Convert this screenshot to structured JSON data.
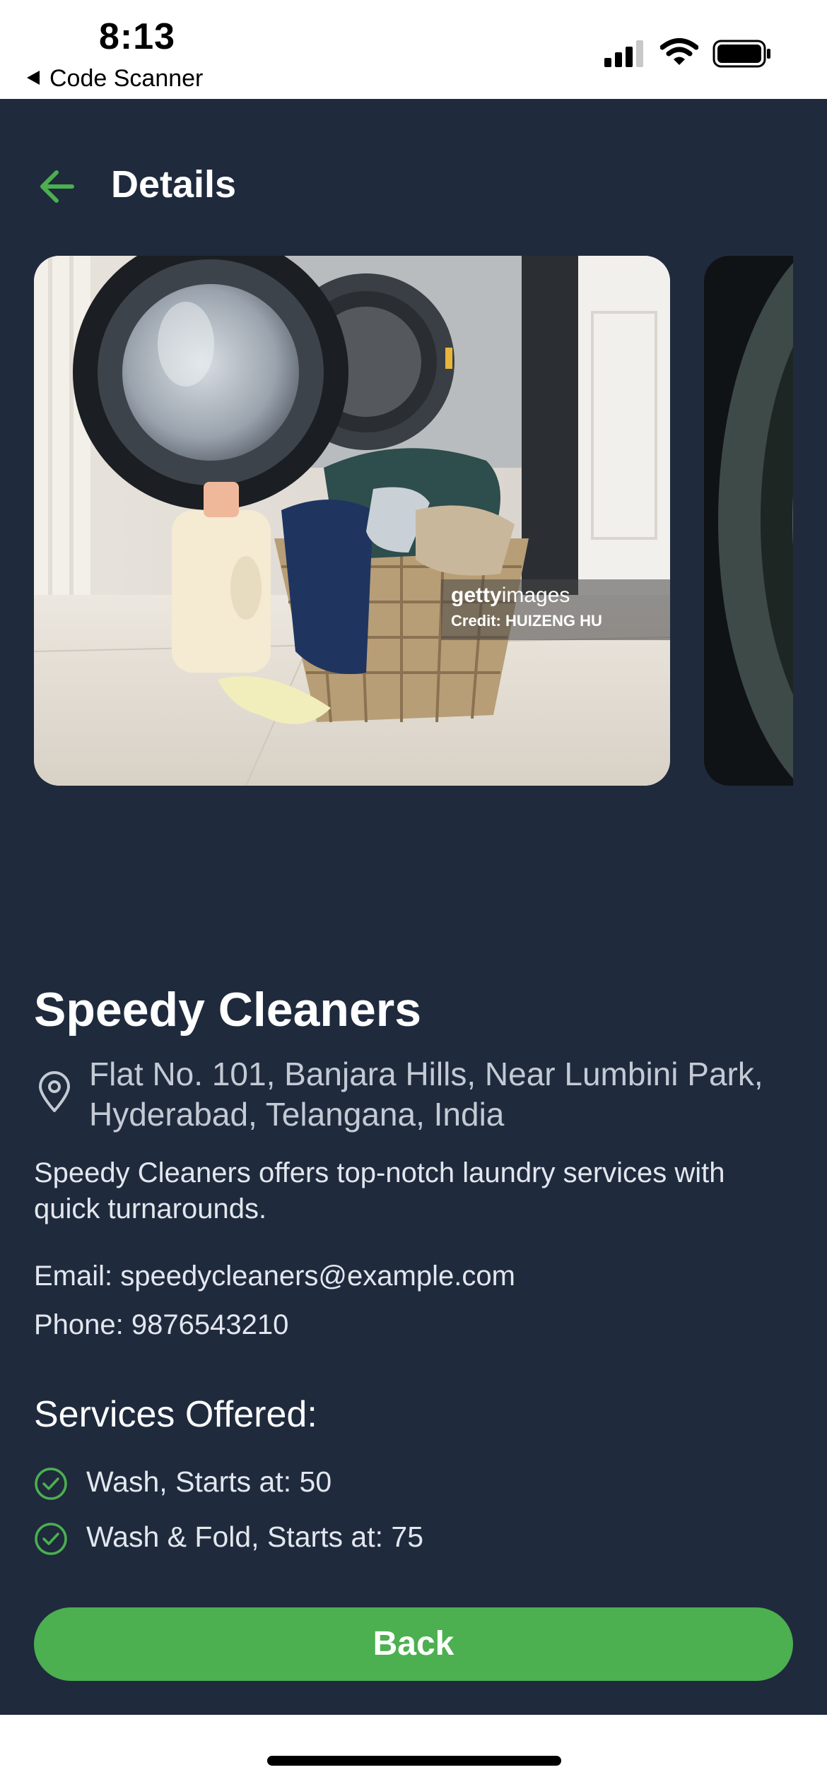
{
  "status_bar": {
    "time": "8:13",
    "back_app_label": "Code Scanner",
    "icons": [
      "signal-icon",
      "wifi-icon",
      "battery-icon"
    ]
  },
  "header": {
    "title": "Details",
    "back_icon": "arrow-left-icon"
  },
  "images": {
    "watermark_brand_bold": "getty",
    "watermark_brand_light": "images",
    "watermark_credit": "Credit: HUIZENG HU"
  },
  "business": {
    "name": "Speedy Cleaners",
    "address_line1": "Flat No. 101, Banjara Hills, Near Lumbini Park,",
    "address_line2": "Hyderabad, Telangana, India",
    "description": "Speedy Cleaners offers top-notch laundry services with quick turnarounds.",
    "email": "Email: speedycleaners@example.com",
    "phone": "Phone: 9876543210"
  },
  "services": {
    "title": "Services Offered:",
    "items": [
      {
        "label": "Wash,  Starts at: 50"
      },
      {
        "label": "Wash & Fold,  Starts at: 75"
      }
    ]
  },
  "actions": {
    "back_label": "Back"
  },
  "colors": {
    "background": "#1f2a3d",
    "accent": "#4caf50",
    "text": "#ffffff"
  }
}
